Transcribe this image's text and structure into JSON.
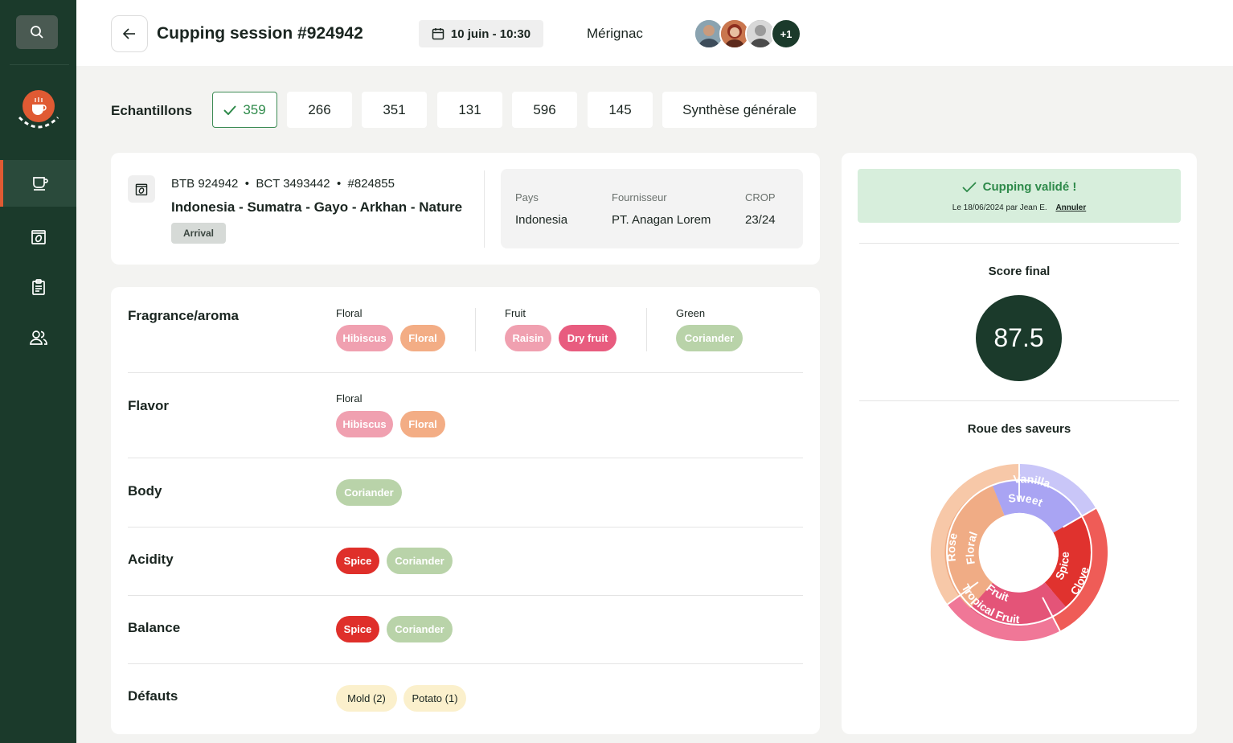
{
  "header": {
    "title": "Cupping session #924942",
    "date": "10 juin - 10:30",
    "location": "Mérignac",
    "more_participants": "+1"
  },
  "samples": {
    "label": "Echantillons",
    "tabs": [
      "359",
      "266",
      "351",
      "131",
      "596",
      "145",
      "Synthèse générale"
    ],
    "active_index": 0
  },
  "lot": {
    "refs": "BTB 924942  •  BCT 3493442  •  #824855",
    "name": "Indonesia - Sumatra - Gayo - Arkhan - Nature",
    "status_badge": "Arrival",
    "pays_label": "Pays",
    "pays_value": "Indonesia",
    "fournisseur_label": "Fournisseur",
    "fournisseur_value": "PT. Anagan Lorem",
    "crop_label": "CROP",
    "crop_value": "23/24"
  },
  "attributes": {
    "fragrance": {
      "label": "Fragrance/aroma",
      "groups": [
        {
          "name": "Floral",
          "tags": [
            "Hibiscus",
            "Floral"
          ]
        },
        {
          "name": "Fruit",
          "tags": [
            "Raisin",
            "Dry fruit"
          ]
        },
        {
          "name": "Green",
          "tags": [
            "Coriander"
          ]
        }
      ]
    },
    "flavor": {
      "label": "Flavor",
      "groups": [
        {
          "name": "Floral",
          "tags": [
            "Hibiscus",
            "Floral"
          ]
        }
      ]
    },
    "body": {
      "label": "Body",
      "tags": [
        "Coriander"
      ]
    },
    "acidity": {
      "label": "Acidity",
      "tags": [
        "Spice",
        "Coriander"
      ]
    },
    "balance": {
      "label": "Balance",
      "tags": [
        "Spice",
        "Coriander"
      ]
    },
    "defects": {
      "label": "Défauts",
      "tags": [
        "Mold (2)",
        "Potato (1)"
      ]
    }
  },
  "validation": {
    "title": "Cupping validé !",
    "subtitle": "Le 18/06/2024 par Jean E.",
    "cancel_link": "Annuler"
  },
  "score": {
    "label": "Score final",
    "value": "87.5"
  },
  "wheel": {
    "title": "Roue des saveurs",
    "inner": [
      {
        "label": "Sweet",
        "color": "#a9a4f3"
      },
      {
        "label": "Spice",
        "color": "#e0322e"
      },
      {
        "label": "Fruit",
        "color": "#e45478"
      },
      {
        "label": "Floral",
        "color": "#f0ac85"
      }
    ],
    "outer": [
      {
        "label": "Vanilla",
        "color": "#c9c6f8"
      },
      {
        "label": "Clove",
        "color": "#ef5c57"
      },
      {
        "label": "Tropical Fruit",
        "color": "#f07797"
      },
      {
        "label": "Rose",
        "color": "#f7c8a8"
      }
    ]
  },
  "colors": {
    "sidebar": "#1b3a2b",
    "accent_green": "#2e8a4a",
    "pill_pink": "#f0a0b0",
    "pill_orange": "#f3ad85",
    "pill_raspberry": "#e85c7f",
    "pill_sage": "#b9d3a9",
    "pill_red": "#df2f2a",
    "pill_cream": "#fbf0cc"
  }
}
